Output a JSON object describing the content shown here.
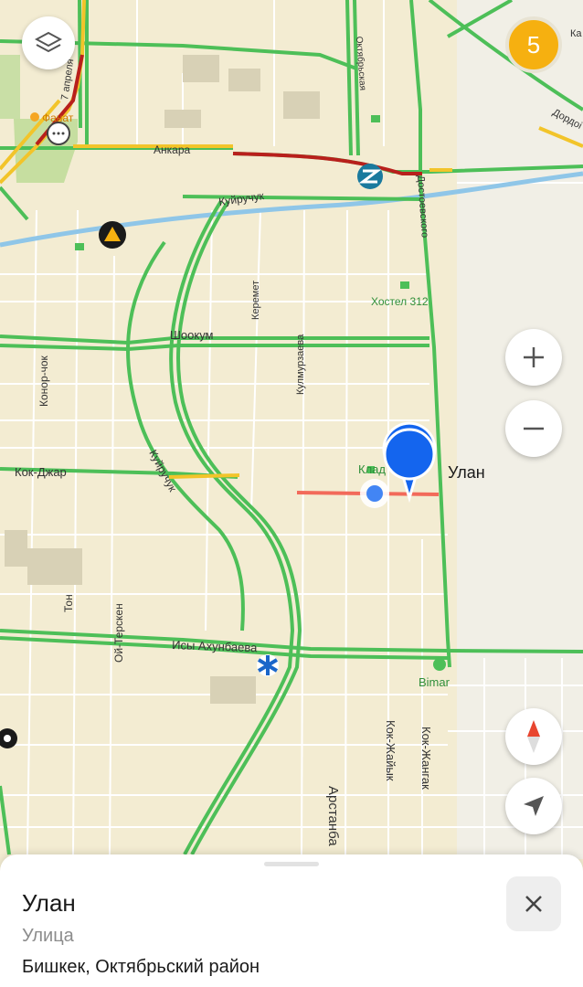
{
  "map": {
    "street_labels": {
      "ankara": "Анкара",
      "kuiruchuk": "Куйручук",
      "kuiruchuk_vertical": "Куйручук",
      "shookum": "Шоокум",
      "keremet": "Керемет",
      "kulmurzaeva": "Кулмурзаева",
      "konorchok": "Конор-чок",
      "kok_jar": "Кок-Джар",
      "ton": "Тон",
      "oi_tersken": "Ой-Терскен",
      "isy_akhunbaeva": "Исы Ахунбаева",
      "kok_jaiyk": "Кок-Жайык",
      "kok_jangak": "Кок-Жангак",
      "artanbaeva": "Арстанба",
      "dostoevskogo": "Достоевского",
      "oktyabrskaya": "Октябрьская",
      "aprelya": "7 апреля",
      "dordoi": "Дордоі",
      "ka": "Ка"
    },
    "poi_labels": {
      "fanat": "Фанат",
      "hostel": "Хостел 312",
      "bimar": "Bimar",
      "klad": "Клад"
    },
    "selected_street_label": "Улан"
  },
  "controls": {
    "traffic_level": "5",
    "layers_icon": "layers-icon",
    "zoom_in_icon": "plus-icon",
    "zoom_out_icon": "minus-icon",
    "compass_icon": "compass-icon",
    "locate_icon": "navigation-arrow-icon"
  },
  "colors": {
    "road_green": "#4dbf58",
    "road_yellow": "#f2c42a",
    "road_red": "#b8201c",
    "river": "#8fc6e8",
    "pin_blue": "#1465ee",
    "highlight_red": "#f26a5a",
    "traffic_badge": "#f6b010"
  },
  "place_card": {
    "title": "Улан",
    "type": "Улица",
    "address": "Бишкек, Октябрьский район",
    "close_icon": "close-icon"
  }
}
